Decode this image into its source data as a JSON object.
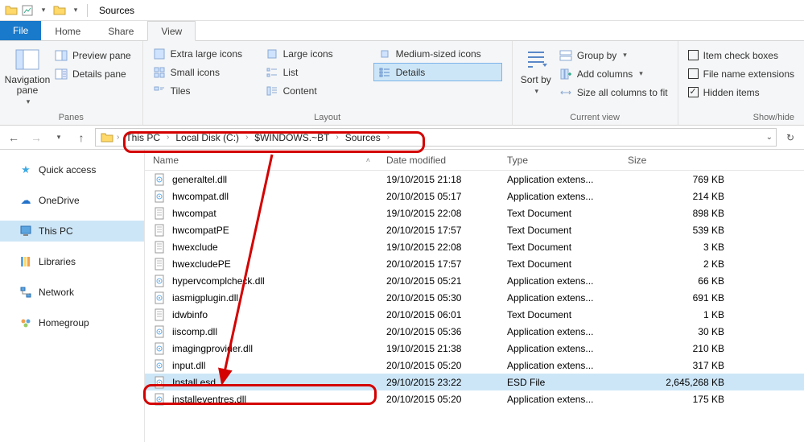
{
  "window": {
    "title": "Sources"
  },
  "menubar": {
    "file": "File",
    "home": "Home",
    "share": "Share",
    "view": "View"
  },
  "ribbon": {
    "panes": {
      "nav": "Navigation pane",
      "preview": "Preview pane",
      "details": "Details pane",
      "label": "Panes"
    },
    "layout": {
      "xl": "Extra large icons",
      "large": "Large icons",
      "medium": "Medium-sized icons",
      "small": "Small icons",
      "list": "List",
      "details": "Details",
      "tiles": "Tiles",
      "content": "Content",
      "label": "Layout"
    },
    "sort": {
      "sort": "Sort by",
      "group": "Group by",
      "addcols": "Add columns",
      "fit": "Size all columns to fit",
      "label": "Current view"
    },
    "show": {
      "cb": "Item check boxes",
      "ext": "File name extensions",
      "hidden": "Hidden items",
      "label": "Show/hide"
    }
  },
  "breadcrumb": [
    "This PC",
    "Local Disk (C:)",
    "$WINDOWS.~BT",
    "Sources"
  ],
  "sidebar": {
    "quick": "Quick access",
    "onedrive": "OneDrive",
    "thispc": "This PC",
    "libraries": "Libraries",
    "network": "Network",
    "homegroup": "Homegroup"
  },
  "columns": {
    "name": "Name",
    "date": "Date modified",
    "type": "Type",
    "size": "Size"
  },
  "files": [
    {
      "name": "generaltel.dll",
      "date": "19/10/2015 21:18",
      "type": "Application extens...",
      "size": "769 KB"
    },
    {
      "name": "hwcompat.dll",
      "date": "20/10/2015 05:17",
      "type": "Application extens...",
      "size": "214 KB"
    },
    {
      "name": "hwcompat",
      "date": "19/10/2015 22:08",
      "type": "Text Document",
      "size": "898 KB"
    },
    {
      "name": "hwcompatPE",
      "date": "20/10/2015 17:57",
      "type": "Text Document",
      "size": "539 KB"
    },
    {
      "name": "hwexclude",
      "date": "19/10/2015 22:08",
      "type": "Text Document",
      "size": "3 KB"
    },
    {
      "name": "hwexcludePE",
      "date": "20/10/2015 17:57",
      "type": "Text Document",
      "size": "2 KB"
    },
    {
      "name": "hypervcomplcheck.dll",
      "date": "20/10/2015 05:21",
      "type": "Application extens...",
      "size": "66 KB"
    },
    {
      "name": "iasmigplugin.dll",
      "date": "20/10/2015 05:30",
      "type": "Application extens...",
      "size": "691 KB"
    },
    {
      "name": "idwbinfo",
      "date": "20/10/2015 06:01",
      "type": "Text Document",
      "size": "1 KB"
    },
    {
      "name": "iiscomp.dll",
      "date": "20/10/2015 05:36",
      "type": "Application extens...",
      "size": "30 KB"
    },
    {
      "name": "imagingprovider.dll",
      "date": "19/10/2015 21:38",
      "type": "Application extens...",
      "size": "210 KB"
    },
    {
      "name": "input.dll",
      "date": "20/10/2015 05:20",
      "type": "Application extens...",
      "size": "317 KB"
    },
    {
      "name": "Install.esd",
      "date": "29/10/2015 23:22",
      "type": "ESD File",
      "size": "2,645,268 KB",
      "selected": true
    },
    {
      "name": "installeventres.dll",
      "date": "20/10/2015 05:20",
      "type": "Application extens...",
      "size": "175 KB"
    }
  ]
}
